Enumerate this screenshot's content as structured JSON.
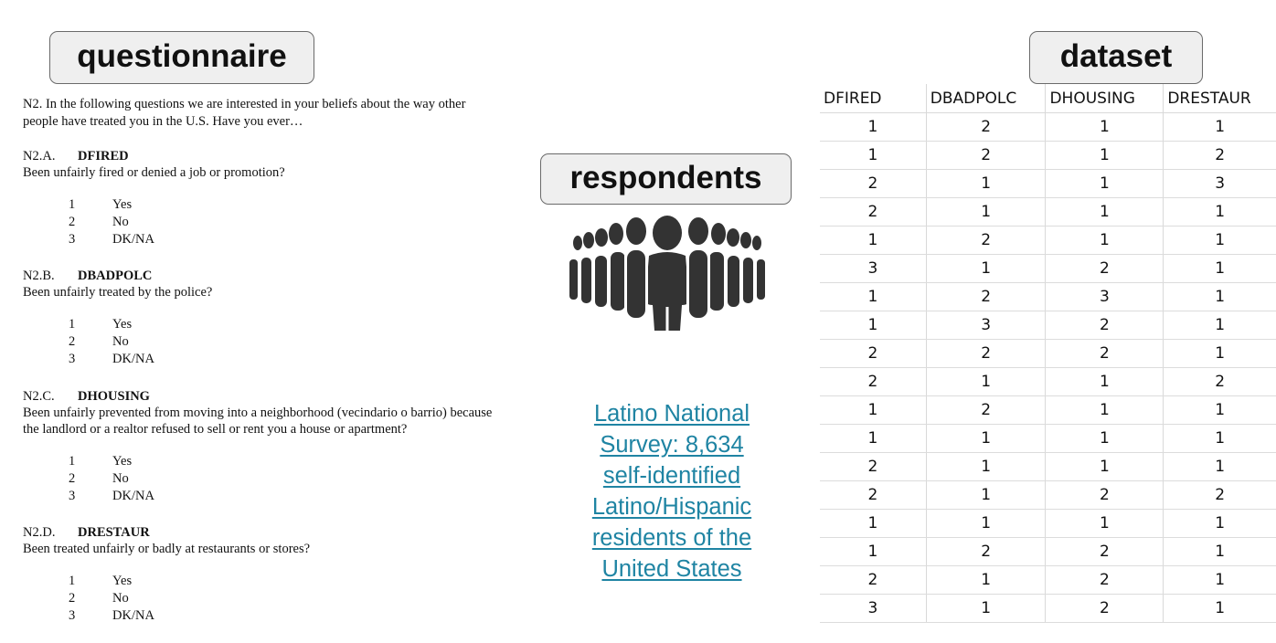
{
  "labels": {
    "questionnaire": "questionnaire",
    "respondents": "respondents",
    "dataset": "dataset"
  },
  "questionnaire": {
    "intro_line1": "N2.  In the following questions we are interested in your beliefs about the way other",
    "intro_line2": "people have treated you in the U.S.  Have you ever…",
    "questions": [
      {
        "code": "N2.A.",
        "var": "DFIRED",
        "text": "Been unfairly fired or denied a job or promotion?",
        "options": [
          {
            "num": "1",
            "label": "Yes"
          },
          {
            "num": "2",
            "label": "No"
          },
          {
            "num": "3",
            "label": "DK/NA"
          }
        ]
      },
      {
        "code": "N2.B.",
        "var": "DBADPOLC",
        "text": "Been unfairly treated by the police?",
        "options": [
          {
            "num": "1",
            "label": "Yes"
          },
          {
            "num": "2",
            "label": "No"
          },
          {
            "num": "3",
            "label": "DK/NA"
          }
        ]
      },
      {
        "code": "N2.C.",
        "var": "DHOUSING",
        "text": "Been unfairly prevented from moving into a neighborhood (vecindario o barrio) because the landlord or a realtor refused to sell or rent you a house or apartment?",
        "text_line1": "Been unfairly prevented from moving into a neighborhood (vecindario o barrio) because",
        "text_line2": "the landlord or a realtor refused to sell or rent you a house or apartment?",
        "options": [
          {
            "num": "1",
            "label": "Yes"
          },
          {
            "num": "2",
            "label": "No"
          },
          {
            "num": "3",
            "label": "DK/NA"
          }
        ]
      },
      {
        "code": "N2.D.",
        "var": "DRESTAUR",
        "text": "Been treated unfairly or badly at restaurants or stores?",
        "options": [
          {
            "num": "1",
            "label": "Yes"
          },
          {
            "num": "2",
            "label": "No"
          },
          {
            "num": "3",
            "label": "DK/NA"
          }
        ]
      }
    ]
  },
  "respondents_icon": "crowd-of-people-icon",
  "description": {
    "line1": "Latino National",
    "line2": "Survey: 8,634",
    "line3": "self-identified",
    "line4": "Latino/Hispanic",
    "line5": "residents of the",
    "line6": "United States"
  },
  "link_color": "#1f84a3",
  "dataset": {
    "columns": [
      "DFIRED",
      "DBADPOLC",
      "DHOUSING",
      "DRESTAUR"
    ],
    "rows": [
      [
        1,
        2,
        1,
        1
      ],
      [
        1,
        2,
        1,
        2
      ],
      [
        2,
        1,
        1,
        3
      ],
      [
        2,
        1,
        1,
        1
      ],
      [
        1,
        2,
        1,
        1
      ],
      [
        3,
        1,
        2,
        1
      ],
      [
        1,
        2,
        3,
        1
      ],
      [
        1,
        3,
        2,
        1
      ],
      [
        2,
        2,
        2,
        1
      ],
      [
        2,
        1,
        1,
        2
      ],
      [
        1,
        2,
        1,
        1
      ],
      [
        1,
        1,
        1,
        1
      ],
      [
        2,
        1,
        1,
        1
      ],
      [
        2,
        1,
        2,
        2
      ],
      [
        1,
        1,
        1,
        1
      ],
      [
        1,
        2,
        2,
        1
      ],
      [
        2,
        1,
        2,
        1
      ],
      [
        3,
        1,
        2,
        1
      ]
    ]
  }
}
